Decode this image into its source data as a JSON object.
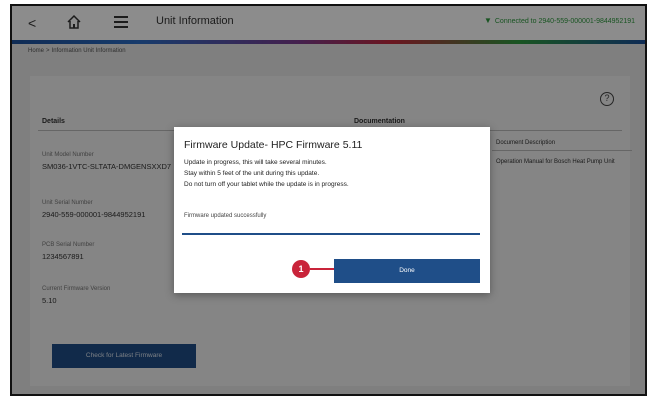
{
  "header": {
    "back_glyph": "<",
    "title": "Unit Information",
    "connection": "Connected to 2940-559-000001-9844952191"
  },
  "breadcrumb": {
    "home": "Home",
    "separator": ">",
    "path": "Information  Unit Information"
  },
  "details": {
    "heading": "Details",
    "fields": [
      {
        "label": "Unit Model Number",
        "value": "SM036-1VTC-SLTATA-DMGENSXXD7"
      },
      {
        "label": "Unit Serial Number",
        "value": "2940-559-000001-9844952191"
      },
      {
        "label": "PCB Serial Number",
        "value": "1234567891"
      },
      {
        "label": "Current Firmware Version",
        "value": "5.10"
      }
    ],
    "check_button": "Check for Latest Firmware"
  },
  "documentation": {
    "heading": "Documentation",
    "column_label": "Document Description",
    "description": "Operation Manual for Bosch Heat Pump Unit"
  },
  "modal": {
    "title": "Firmware Update- HPC Firmware 5.11",
    "lines": [
      "Update in progress, this will take several minutes.",
      "Stay within 5 feet of the unit during this update.",
      "Do not turn off your tablet while the update is in progress."
    ],
    "status": "Firmware updated successfully",
    "progress": 1.0,
    "done_label": "Done",
    "callout_number": "1"
  },
  "icons": {
    "help": "?",
    "home": "home-icon",
    "menu": "menu-icon",
    "wifi": "wifi-icon"
  },
  "colors": {
    "primary": "#1f4e88",
    "callout": "#c9243a",
    "connected": "#2e9a3e"
  }
}
